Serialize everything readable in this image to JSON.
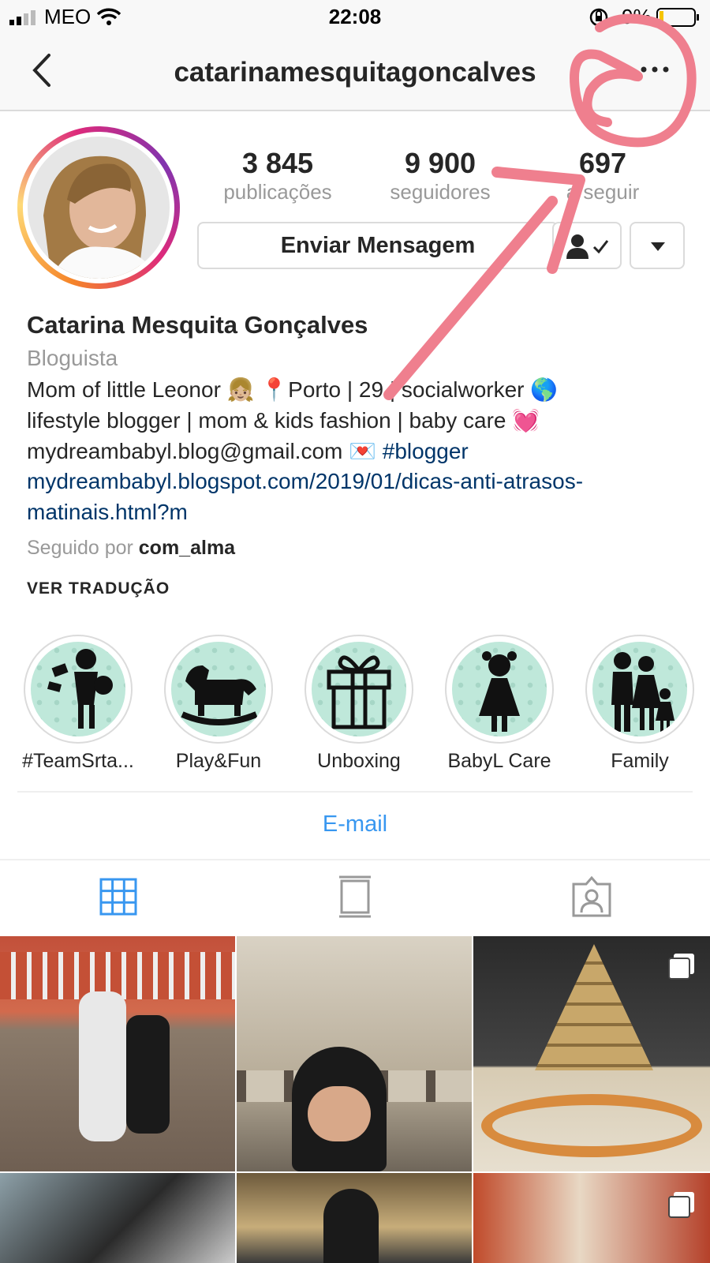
{
  "status_bar": {
    "carrier": "MEO",
    "time": "22:08",
    "battery": "9%"
  },
  "nav": {
    "username": "catarinamesquitagoncalves"
  },
  "profile": {
    "stats": [
      {
        "value": "3 845",
        "label": "publicações"
      },
      {
        "value": "9 900",
        "label": "seguidores"
      },
      {
        "value": "697",
        "label": "a seguir"
      }
    ],
    "message_button": "Enviar Mensagem",
    "name": "Catarina Mesquita Gonçalves",
    "category": "Bloguista",
    "bio_line1": "Mom of little Leonor 👧🏼 📍Porto | 29 | socialworker 🌎",
    "bio_line2": "lifestyle blogger | mom & kids fashion | baby care 💓",
    "bio_line3_email": "mydreambabyl.blog@gmail.com 💌 ",
    "bio_line3_tag": "#blogger",
    "website_line1": "mydreambabyl.blogspot.com/2019/01/dicas-anti-atrasos-",
    "website_line2": "matinais.html?m",
    "followed_prefix": "Seguido por ",
    "followed_user": "com_alma",
    "translate": "VER TRADUÇÃO"
  },
  "highlights": [
    {
      "label": "#TeamSrta...",
      "icon": "dancing-girl-icon"
    },
    {
      "label": "Play&Fun",
      "icon": "rocking-horse-icon"
    },
    {
      "label": "Unboxing",
      "icon": "gift-icon"
    },
    {
      "label": "BabyL Care",
      "icon": "girl-icon"
    },
    {
      "label": "Family",
      "icon": "family-icon"
    }
  ],
  "contact": {
    "email_label": "E-mail"
  },
  "tabs": [
    "grid-icon",
    "feed-icon",
    "tagged-icon"
  ],
  "colors": {
    "accent": "#3897f0",
    "annotation": "#ef7f8e",
    "link": "#003569"
  }
}
